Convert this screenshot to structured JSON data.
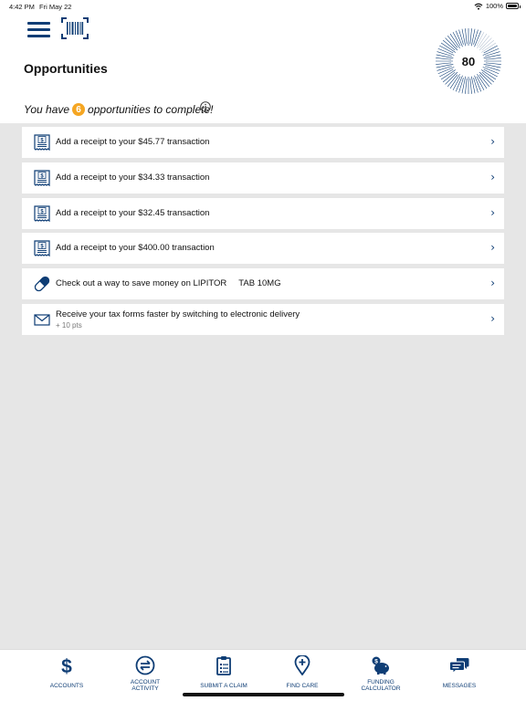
{
  "status_bar": {
    "time": "4:42 PM",
    "date": "Fri May 22",
    "battery": "100%"
  },
  "header": {
    "title": "Opportunities",
    "score": "80"
  },
  "subtitle": {
    "prefix": "You have",
    "count": "6",
    "suffix": "opportunities to complete!"
  },
  "opportunities": [
    {
      "label": "Add a receipt to your $45.77 transaction",
      "icon": "receipt-icon"
    },
    {
      "label": "Add a receipt to your $34.33 transaction",
      "icon": "receipt-icon"
    },
    {
      "label": "Add a receipt to your $32.45 transaction",
      "icon": "receipt-icon"
    },
    {
      "label": "Add a receipt to your $400.00 transaction",
      "icon": "receipt-icon"
    },
    {
      "label": "Check out a way to save money on LIPITOR     TAB 10MG",
      "icon": "pill-icon"
    },
    {
      "label": "Receive your tax forms faster by switching to electronic delivery",
      "sub": "+ 10 pts",
      "icon": "envelope-icon"
    }
  ],
  "tabs": [
    {
      "label": "ACCOUNTS",
      "icon": "dollar-icon"
    },
    {
      "label": "ACCOUNT ACTIVITY",
      "icon": "exchange-icon"
    },
    {
      "label": "SUBMIT A CLAIM",
      "icon": "clipboard-icon"
    },
    {
      "label": "FIND CARE",
      "icon": "location-plus-icon"
    },
    {
      "label": "FUNDING CALCULATOR",
      "icon": "piggy-bank-icon"
    },
    {
      "label": "MESSAGES",
      "icon": "chat-bubbles-icon"
    }
  ],
  "colors": {
    "brand": "#0e3d75",
    "badge": "#f5a623",
    "background": "#e6e6e6"
  }
}
